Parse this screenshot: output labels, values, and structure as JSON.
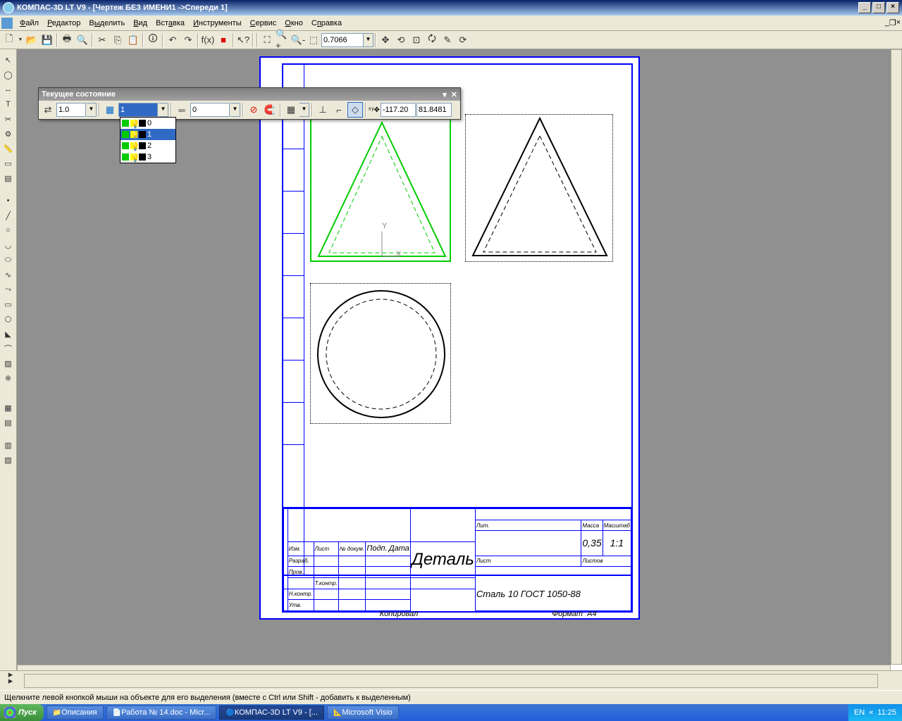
{
  "title": "КОМПАС-3D LT V9 - [Чертеж БЕЗ ИМЕНИ1 ->Спереди 1]",
  "menu": {
    "file": "Файл",
    "edit": "Редактор",
    "select": "Выделить",
    "view": "Вид",
    "insert": "Вставка",
    "tools": "Инструменты",
    "service": "Сервис",
    "window": "Окно",
    "help": "Справка"
  },
  "zoom": "0.7066",
  "floatbar": {
    "title": "Текущее состояние",
    "step": "1.0",
    "layer_input": "1",
    "style": "0",
    "x": "-117.20",
    "y": "81.8481",
    "xlbl": "x",
    "ylbl": "y"
  },
  "layers": [
    {
      "name": "0"
    },
    {
      "name": "1",
      "selected": true
    },
    {
      "name": "2"
    },
    {
      "name": "3"
    }
  ],
  "titleblock": {
    "part": "Деталь",
    "material": "Сталь 10  ГОСТ 1050-88",
    "lit": "Лит.",
    "mass": "Масса",
    "scale": "Масштаб",
    "massval": "0,35",
    "scaleval": "1:1",
    "sheet": "Лист",
    "sheets": "Листов",
    "rows": [
      "Изм.",
      "Разраб.",
      "Пров.",
      "Т.контр.",
      "Н.контр.",
      "Утв."
    ],
    "cols": [
      "Лист",
      "№ докум.",
      "Подп.",
      "Дата"
    ],
    "copy": "Копировал",
    "fmt": "Формат",
    "fmtv": "А4"
  },
  "status": "Щелкните левой кнопкой мыши на объекте для его выделения (вместе с Ctrl или Shift - добавить к выделенным)",
  "taskbar": {
    "start": "Пуск",
    "items": [
      {
        "label": "Описания",
        "icon": "folder"
      },
      {
        "label": "Работа № 14.doc - Micr...",
        "icon": "word"
      },
      {
        "label": "КОМПАС-3D LT V9 - [...",
        "icon": "kompas",
        "active": true
      },
      {
        "label": "Microsoft Visio",
        "icon": "visio"
      }
    ],
    "lang": "EN",
    "time": "11:25"
  }
}
